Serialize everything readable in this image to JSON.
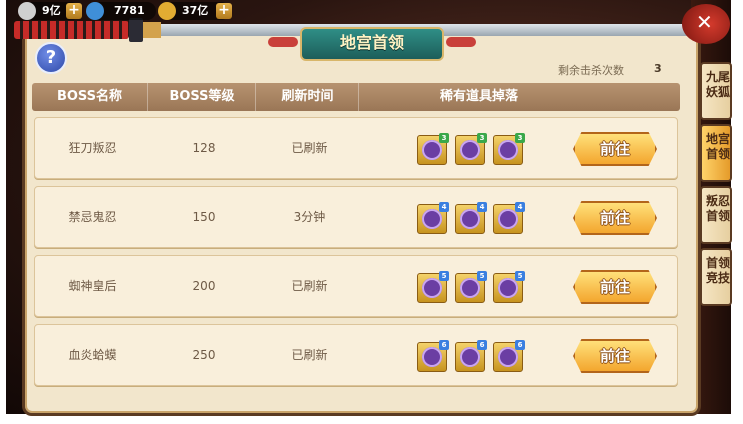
{
  "resources": [
    {
      "name": "silver",
      "value": "9亿",
      "color": "#d9d9d9"
    },
    {
      "name": "gem",
      "value": "7781",
      "color": "#4aa8e8"
    },
    {
      "name": "gold",
      "value": "37亿",
      "color": "#e6b23a"
    }
  ],
  "title": "地宫首领",
  "remaining": {
    "label": "剩余击杀次数",
    "value": "3"
  },
  "table": {
    "headers": [
      "BOSS名称",
      "BOSS等级",
      "刷新时间",
      "稀有道具掉落"
    ],
    "rows": [
      {
        "name": "狂刀叛忍",
        "level": "128",
        "refresh": "已刷新",
        "drops": [
          "3",
          "3",
          "3"
        ],
        "action": "前往"
      },
      {
        "name": "禁忌鬼忍",
        "level": "150",
        "refresh": "3分钟",
        "drops": [
          "4",
          "4",
          "4"
        ],
        "action": "前往"
      },
      {
        "name": "蜘神皇后",
        "level": "200",
        "refresh": "已刷新",
        "drops": [
          "5",
          "5",
          "5"
        ],
        "action": "前往"
      },
      {
        "name": "血炎蛤蟆",
        "level": "250",
        "refresh": "已刷新",
        "drops": [
          "6",
          "6",
          "6"
        ],
        "action": "前往"
      }
    ]
  },
  "side_tabs": [
    "九尾妖狐",
    "地宫首领",
    "叛忍首领",
    "首领竞技"
  ],
  "colors": {
    "badge3": "#3aa84a",
    "badge4": "#3a7fe0",
    "badge5": "#3a7fe0",
    "badge6": "#3a7fe0",
    "accent": "#f3a62e"
  }
}
